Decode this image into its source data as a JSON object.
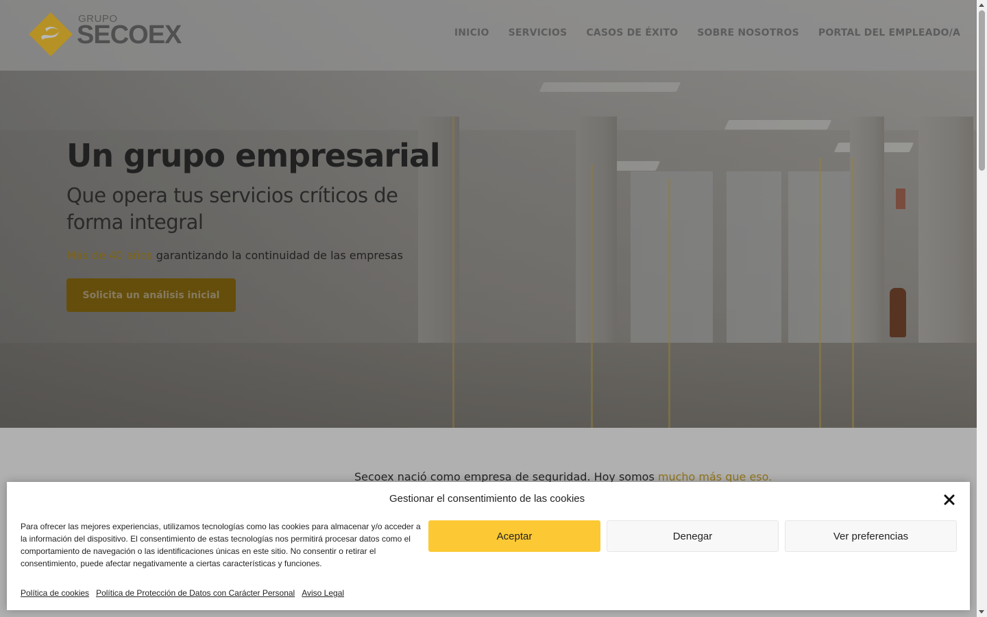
{
  "brand": {
    "logo_small": "GRUPO",
    "logo_name": "SECOEX",
    "accent_color": "#fcc934",
    "gold_text_color": "#b08a1a"
  },
  "nav": {
    "items": [
      "INICIO",
      "SERVICIOS",
      "CASOS DE ÉXITO",
      "SOBRE NOSOTROS",
      "PORTAL DEL EMPLEADO/A"
    ]
  },
  "hero": {
    "title": "Un grupo empresarial",
    "subtitle": "Que opera tus servicios críticos de forma integral",
    "tagline_highlight": "Más de 40 años",
    "tagline_rest": " garantizando la continuidad de las empresas",
    "cta_label": "Solicita un análisis inicial"
  },
  "intro": {
    "text": "Secoex nació como empresa de seguridad. Hoy somos ",
    "highlight": "mucho más que eso."
  },
  "cookie_banner": {
    "title": "Gestionar el consentimiento de las cookies",
    "message": "Para ofrecer las mejores experiencias, utilizamos tecnologías como las cookies para almacenar y/o acceder a la información del dispositivo. El consentimiento de estas tecnologías nos permitirá procesar datos como el comportamiento de navegación o las identificaciones únicas en este sitio. No consentir o retirar el consentimiento, puede afectar negativamente a ciertas características y funciones.",
    "accept_label": "Aceptar",
    "deny_label": "Denegar",
    "prefs_label": "Ver preferencias",
    "links": [
      "Política de cookies",
      "Política de Protección de Datos con Carácter Personal",
      "Aviso Legal"
    ],
    "close_icon": "close-icon"
  }
}
